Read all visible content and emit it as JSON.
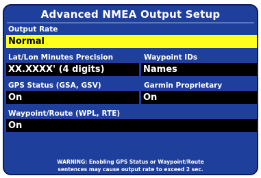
{
  "title": "Advanced NMEA Output Setup",
  "output_rate": {
    "label": "Output Rate",
    "value": "Normal"
  },
  "latlon_precision": {
    "label": "Lat/Lon Minutes Precision",
    "value": "XX.XXXX' (4 digits)"
  },
  "waypoint_ids": {
    "label": "Waypoint IDs",
    "value": "Names"
  },
  "gps_status": {
    "label": "GPS Status (GSA, GSV)",
    "value": "On"
  },
  "garmin_proprietary": {
    "label": "Garmin Proprietary",
    "value": "On"
  },
  "waypoint_route": {
    "label": "Waypoint/Route (WPL, RTE)",
    "value": "On"
  },
  "warning": {
    "line1": "WARNING: Enabling GPS Status or Waypoint/Route",
    "line2": "sentences may cause output rate to exceed 2 sec."
  },
  "colors": {
    "background": "#1f3f9c",
    "field": "#000000",
    "selected_field": "#ffff1e",
    "text": "#ffffff"
  }
}
